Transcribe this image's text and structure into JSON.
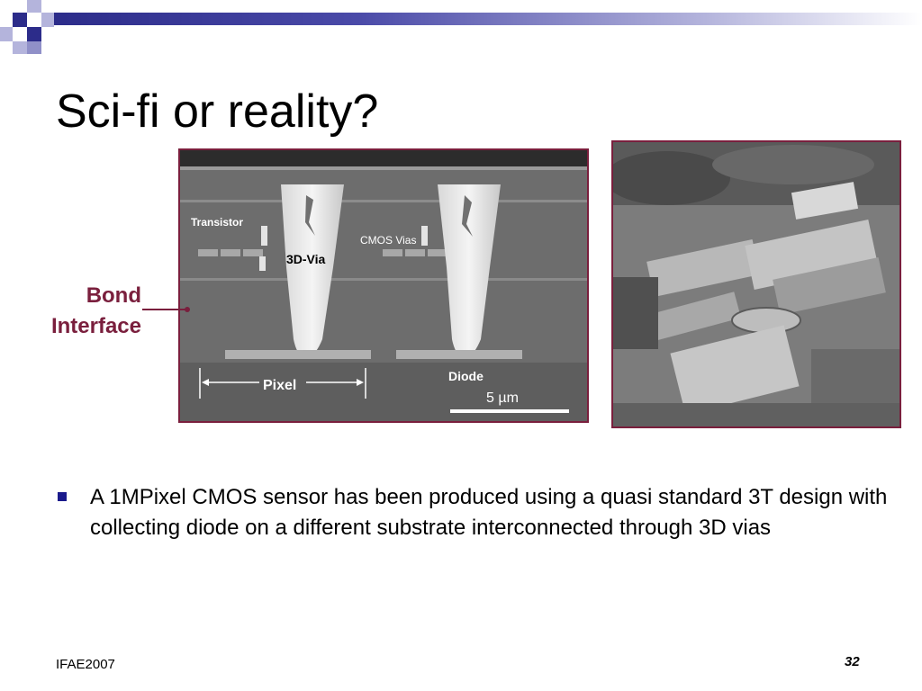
{
  "slide": {
    "title": "Sci-fi or reality?",
    "bullet": "A 1MPixel CMOS sensor has been produced using a quasi standard 3T design with collecting diode on a different substrate interconnected through 3D vias",
    "footer_left": "IFAE2007",
    "page_number": "32"
  },
  "bond_interface": {
    "line1": "Bond",
    "line2": "Interface"
  },
  "cross_section": {
    "transistor": "Transistor",
    "via_3d": "3D-Via",
    "cmos_vias": "CMOS Vias",
    "pixel": "Pixel",
    "diode": "Diode",
    "scale": "5 µm"
  },
  "colors": {
    "accent": "#7a1f3d",
    "bullet": "#1a1a8c",
    "rule": "#2c2c8a"
  }
}
